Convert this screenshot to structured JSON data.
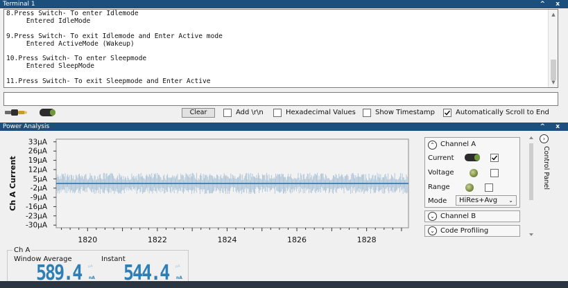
{
  "terminal": {
    "title": "Terminal 1",
    "window_controls": "^ x",
    "lines": [
      "8.Press Switch- To enter Idlemode",
      "     Entered IdleMode",
      "",
      "9.Press Switch- To exit Idlemode and Enter Active mode",
      "     Entered ActiveMode (Wakeup)",
      "",
      "10.Press Switch- To enter Sleepmode",
      "     Entered SleepMode",
      "",
      "11.Press Switch- To exit Sleepmode and Enter Active"
    ],
    "input_value": "",
    "toolbar": {
      "clear_label": "Clear",
      "add_rn_label": "Add \\r\\n",
      "add_rn_checked": false,
      "hex_label": "Hexadecimal Values",
      "hex_checked": false,
      "timestamp_label": "Show Timestamp",
      "timestamp_checked": false,
      "autoscroll_label": "Automatically Scroll to End",
      "autoscroll_checked": true
    }
  },
  "power_analysis": {
    "title": "Power Analysis",
    "window_controls": "^ x",
    "control_panel": {
      "tab_label": "Control Panel",
      "channel_a": {
        "label": "Channel A",
        "current_label": "Current",
        "current_checked": true,
        "voltage_label": "Voltage",
        "voltage_checked": false,
        "range_label": "Range",
        "range_checked": false,
        "mode_label": "Mode",
        "mode_value": "HiRes+Avg"
      },
      "channel_b_label": "Channel B",
      "code_profiling_label": "Code Profiling"
    },
    "readout": {
      "group_label": "Ch A",
      "window_average_label": "Window Average",
      "window_average_value": "589.4",
      "window_average_unit": "nA",
      "instant_label": "Instant",
      "instant_value": "544.4",
      "instant_unit": "nA"
    }
  },
  "chart_data": {
    "type": "line",
    "ylabel": "Ch A Current",
    "yticks": [
      "33µA",
      "26µA",
      "19µA",
      "12µA",
      "5µA",
      "-2µA",
      "-9µA",
      "-16µA",
      "-23µA",
      "-30µA"
    ],
    "ytick_values_uA": [
      33,
      26,
      19,
      12,
      5,
      -2,
      -9,
      -16,
      -23,
      -30
    ],
    "ylim_uA": [
      -32,
      35
    ],
    "xticks": [
      "1820",
      "1822",
      "1824",
      "1826",
      "1828"
    ],
    "xtick_values": [
      1820,
      1822,
      1824,
      1826,
      1828
    ],
    "xlim": [
      1819.1,
      1829.2
    ],
    "series": [
      {
        "role": "raw-samples",
        "color": "#9fbbd2",
        "y_range_uA": [
          -6.5,
          9.5
        ]
      },
      {
        "role": "average",
        "color": "#2a6a9e",
        "y_value_uA": 1.5
      }
    ],
    "grid": false,
    "plot_background": "#f2f2f2"
  },
  "colors": {
    "header_bg": "#1d4f7d",
    "bottom_bar": "#2b3441",
    "readout_blue": "#2f7fb7"
  }
}
